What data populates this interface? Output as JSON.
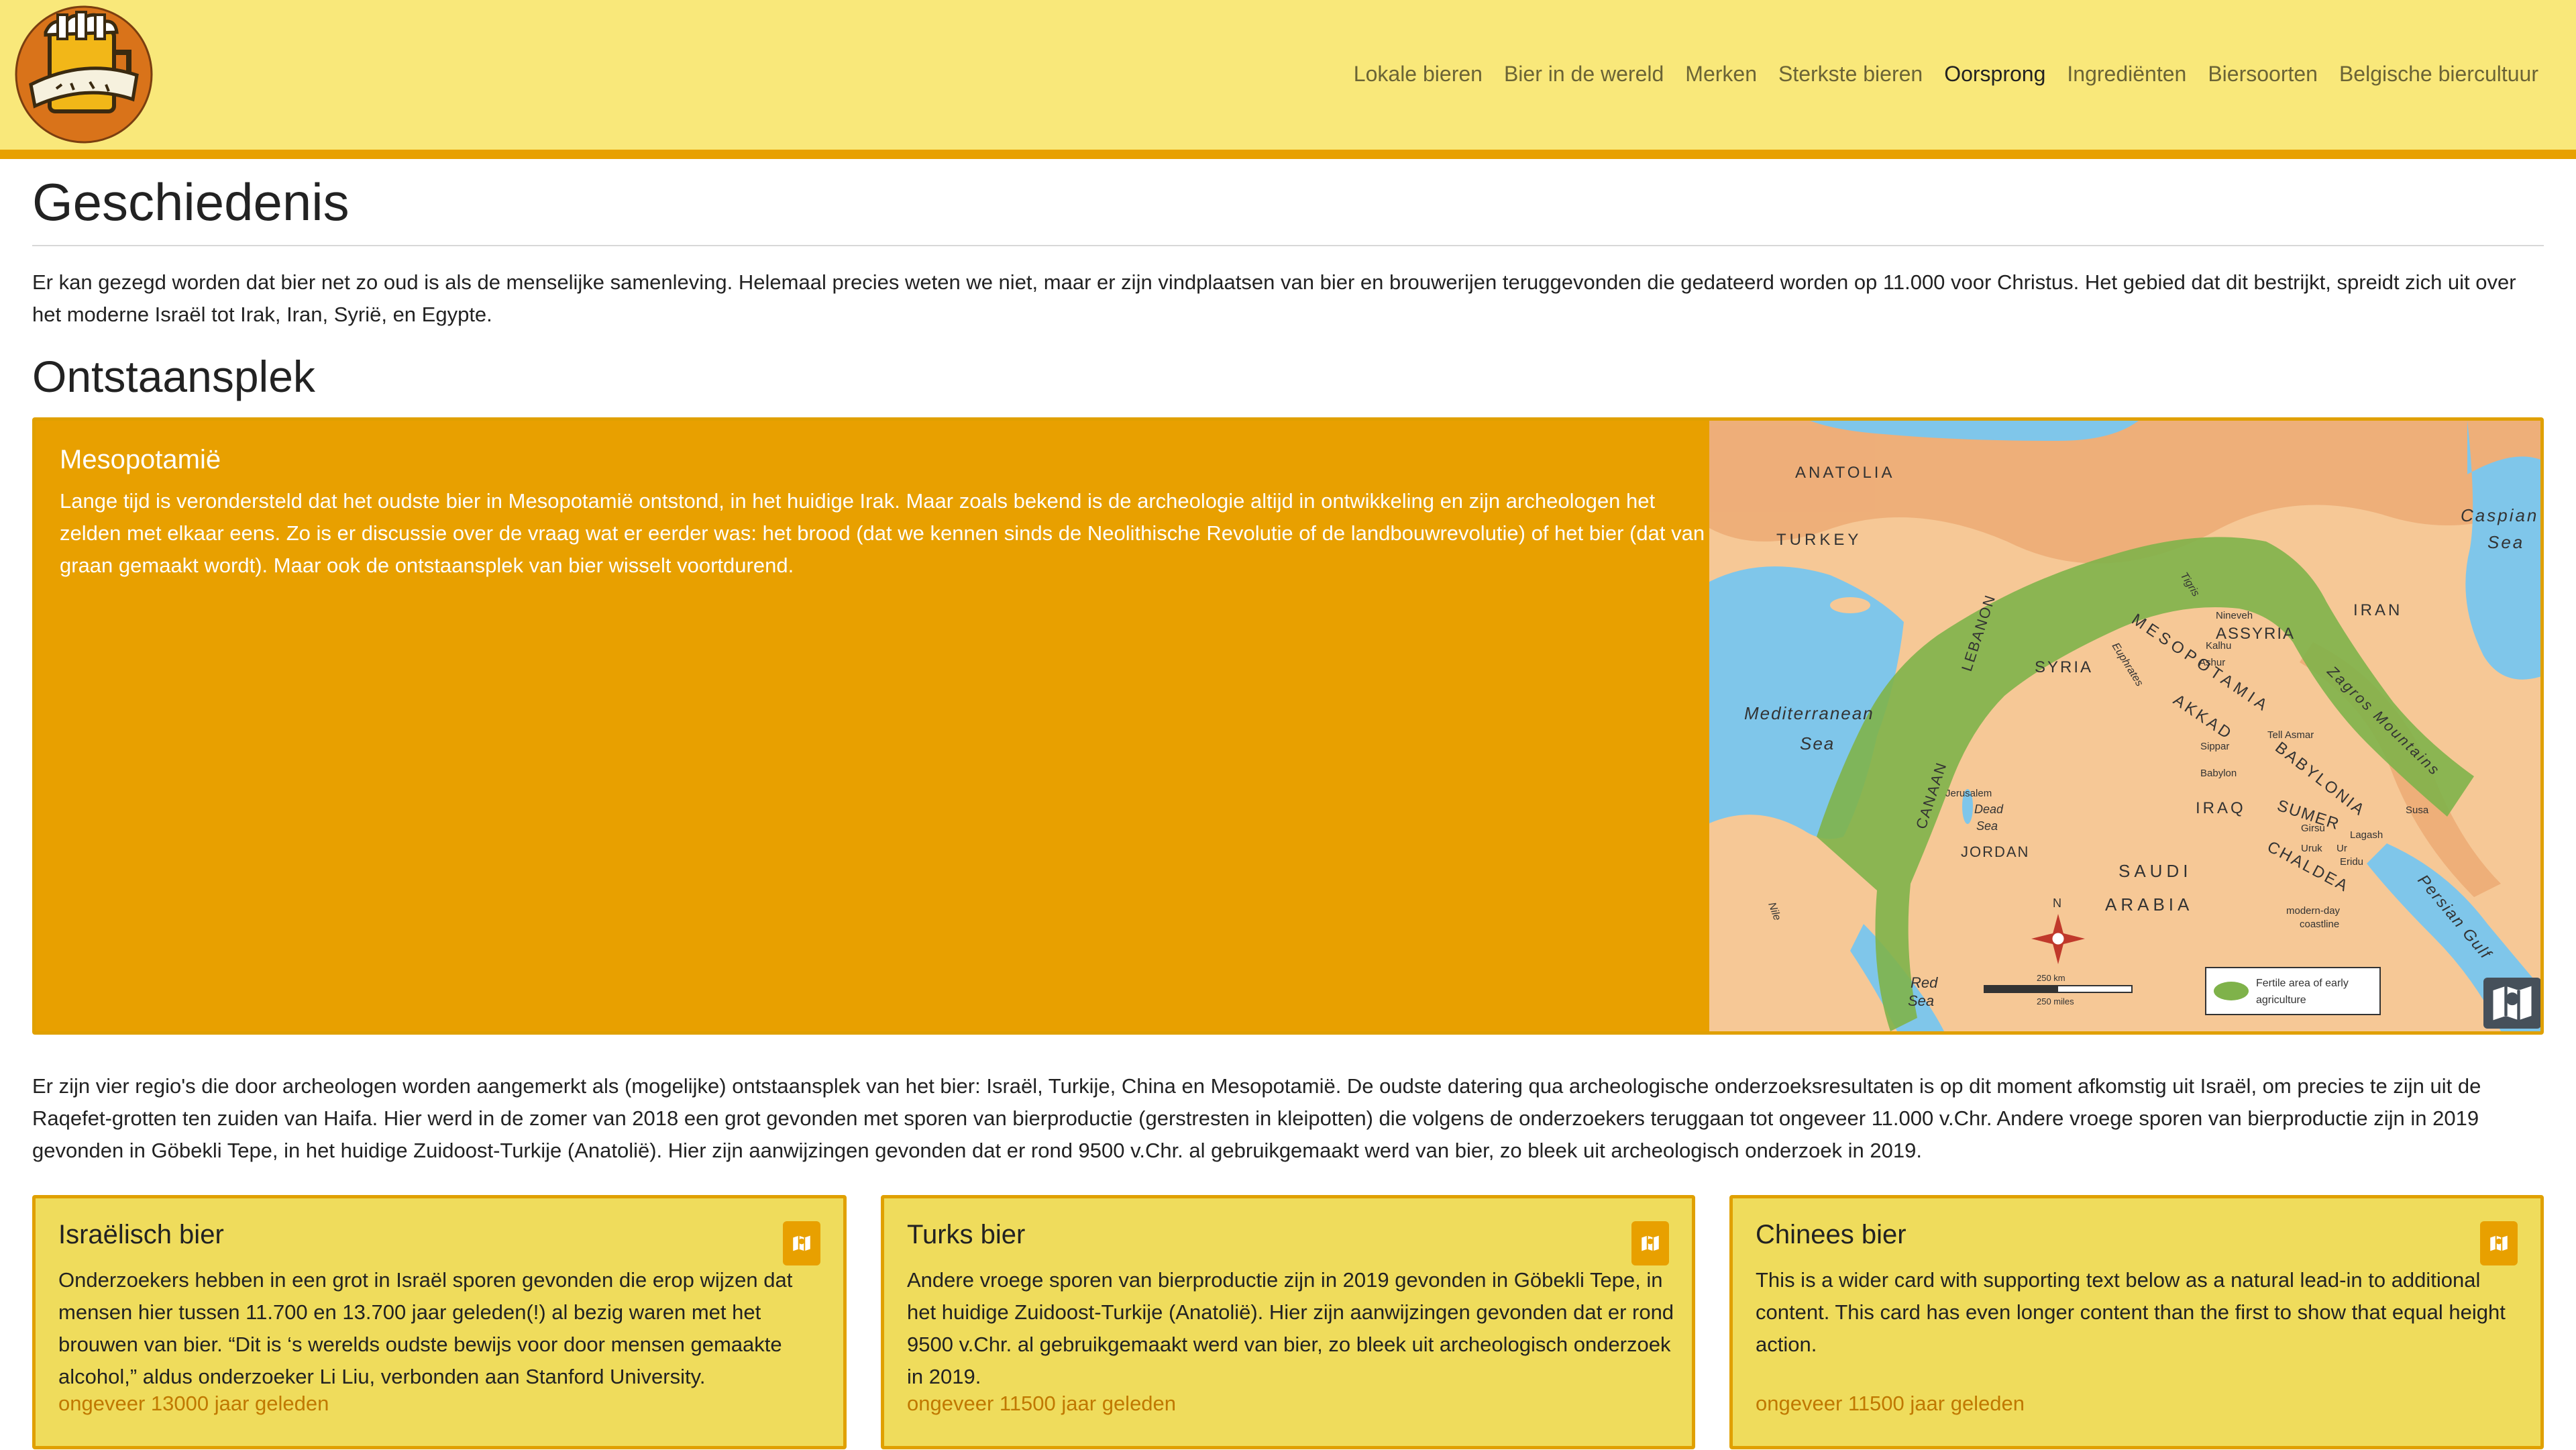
{
  "site": {
    "logo_alt": "Just Bills logo"
  },
  "nav": {
    "items": [
      {
        "label": "Lokale bieren",
        "active": false
      },
      {
        "label": "Bier in de wereld",
        "active": false
      },
      {
        "label": "Merken",
        "active": false
      },
      {
        "label": "Sterkste bieren",
        "active": false
      },
      {
        "label": "Oorsprong",
        "active": true
      },
      {
        "label": "Ingrediënten",
        "active": false
      },
      {
        "label": "Biersoorten",
        "active": false
      },
      {
        "label": "Belgische biercultuur",
        "active": false
      }
    ]
  },
  "page": {
    "title": "Geschiedenis",
    "intro": "Er kan gezegd worden dat bier net zo oud is als de menselijke samenleving. Helemaal precies weten we niet, maar er zijn vindplaatsen van bier en brouwerijen teruggevonden die gedateerd worden op 11.000 voor Christus. Het gebied dat dit bestrijkt, spreidt zich uit over het moderne Israël tot Irak, Iran, Syrië, en Egypte.",
    "section_title": "Ontstaansplek"
  },
  "feature": {
    "title": "Mesopotamië",
    "text": "Lange tijd is verondersteld dat het oudste bier in Mesopotamië ontstond, in het huidige Irak. Maar zoals bekend is de archeologie altijd in ontwikkeling en zijn archeologen het zelden met elkaar eens. Zo is er discussie over de vraag wat er eerder was: het brood (dat we kennen sinds de Neolithische Revolutie of de landbouwrevolutie) of het bier (dat van graan gemaakt wordt). Maar ook de ontstaansplek van bier wisselt voortdurend.",
    "map": {
      "labels": {
        "anatolia": "ANATOLIA",
        "turkey": "TURKEY",
        "caspian1": "Caspian",
        "caspian2": "Sea",
        "iran": "IRAN",
        "med1": "Mediterranean",
        "med2": "Sea",
        "syria": "SYRIA",
        "mesopotamia": "MESOPOTAMIA",
        "assyria": "ASSYRIA",
        "nineveh": "Nineveh",
        "kalhu": "Kalhu",
        "ashur": "Ashur",
        "akkad": "AKKAD",
        "tellasmar": "Tell Asmar",
        "sippar": "Sippar",
        "babylon": "Babylon",
        "babylonia": "BABYLONIA",
        "zagros": "Zagros Mountains",
        "lebanon": "LEBANON",
        "canaan": "CANAAN",
        "euphrates": "Euphrates",
        "tigris": "Tigris",
        "iraq": "IRAQ",
        "sumer": "SUMER",
        "susa": "Susa",
        "jerusalem": "Jerusalem",
        "deadsea1": "Dead",
        "deadsea2": "Sea",
        "jordan": "JORDAN",
        "girsu": "Girsu",
        "lagash": "Lagash",
        "uruk": "Uruk",
        "ur": "Ur",
        "eridu": "Eridu",
        "chaldea": "CHALDEA",
        "saudi": "SAUDI",
        "arabia": "ARABIA",
        "nile": "Nile",
        "n": "N",
        "coast1": "modern-day",
        "coast2": "coastline",
        "persiangulf": "Persian Gulf",
        "redsea1": "Red",
        "redsea2": "Sea",
        "km": "250 km",
        "miles": "250 miles",
        "legend1": "Fertile area of early",
        "legend2": "agriculture"
      }
    }
  },
  "para2": "Er zijn vier regio's die door archeologen worden aangemerkt als (mogelijke) ontstaansplek van het bier: Israël, Turkije, China en Mesopotamië. De oudste datering qua archeologische onderzoeksresultaten is op dit moment afkomstig uit Israël, om precies te zijn uit de Raqefet-grotten ten zuiden van Haifa. Hier werd in de zomer van 2018 een grot gevonden met sporen van bierproductie (gerstresten in kleipotten) die volgens de onderzoekers teruggaan tot ongeveer 11.000 v.Chr. Andere vroege sporen van bierproductie zijn in 2019 gevonden in Göbekli Tepe, in het huidige Zuidoost-Turkije (Anatolië). Hier zijn aanwijzingen gevonden dat er rond 9500 v.Chr. al gebruikgemaakt werd van bier, zo bleek uit archeologisch onderzoek in 2019.",
  "cards": [
    {
      "title": "Israëlisch bier",
      "text": "Onderzoekers hebben in een grot in Israël sporen gevonden die erop wijzen dat mensen hier tussen 11.700 en 13.700 jaar geleden(!) al bezig waren met het brouwen van bier. “Dit is ‘s werelds oudste bewijs voor door mensen gemaakte alcohol,” aldus onderzoeker Li Liu, verbonden aan Stanford University.",
      "footer": "ongeveer 13000 jaar geleden"
    },
    {
      "title": "Turks bier",
      "text": "Andere vroege sporen van bierproductie zijn in 2019 gevonden in Göbekli Tepe, in het huidige Zuidoost-Turkije (Anatolië). Hier zijn aanwijzingen gevonden dat er rond 9500 v.Chr. al gebruikgemaakt werd van bier, zo bleek uit archeologisch onderzoek in 2019.",
      "footer": "ongeveer 11500 jaar geleden"
    },
    {
      "title": "Chinees bier",
      "text": "This is a wider card with supporting text below as a natural lead-in to additional content. This card has even longer content than the first to show that equal height action.",
      "footer": "ongeveer 11500 jaar geleden"
    }
  ],
  "icons": {
    "map_button": "map-icon",
    "card_icon": "map-icon"
  },
  "colors": {
    "navbar_bg": "#f9e87a",
    "accent": "#e8a000",
    "card_bg": "#efdc5c",
    "footer_text": "#c07800",
    "map_water": "#7fc6ea",
    "map_land": "#f6c896",
    "fertile": "#7fb24a"
  }
}
